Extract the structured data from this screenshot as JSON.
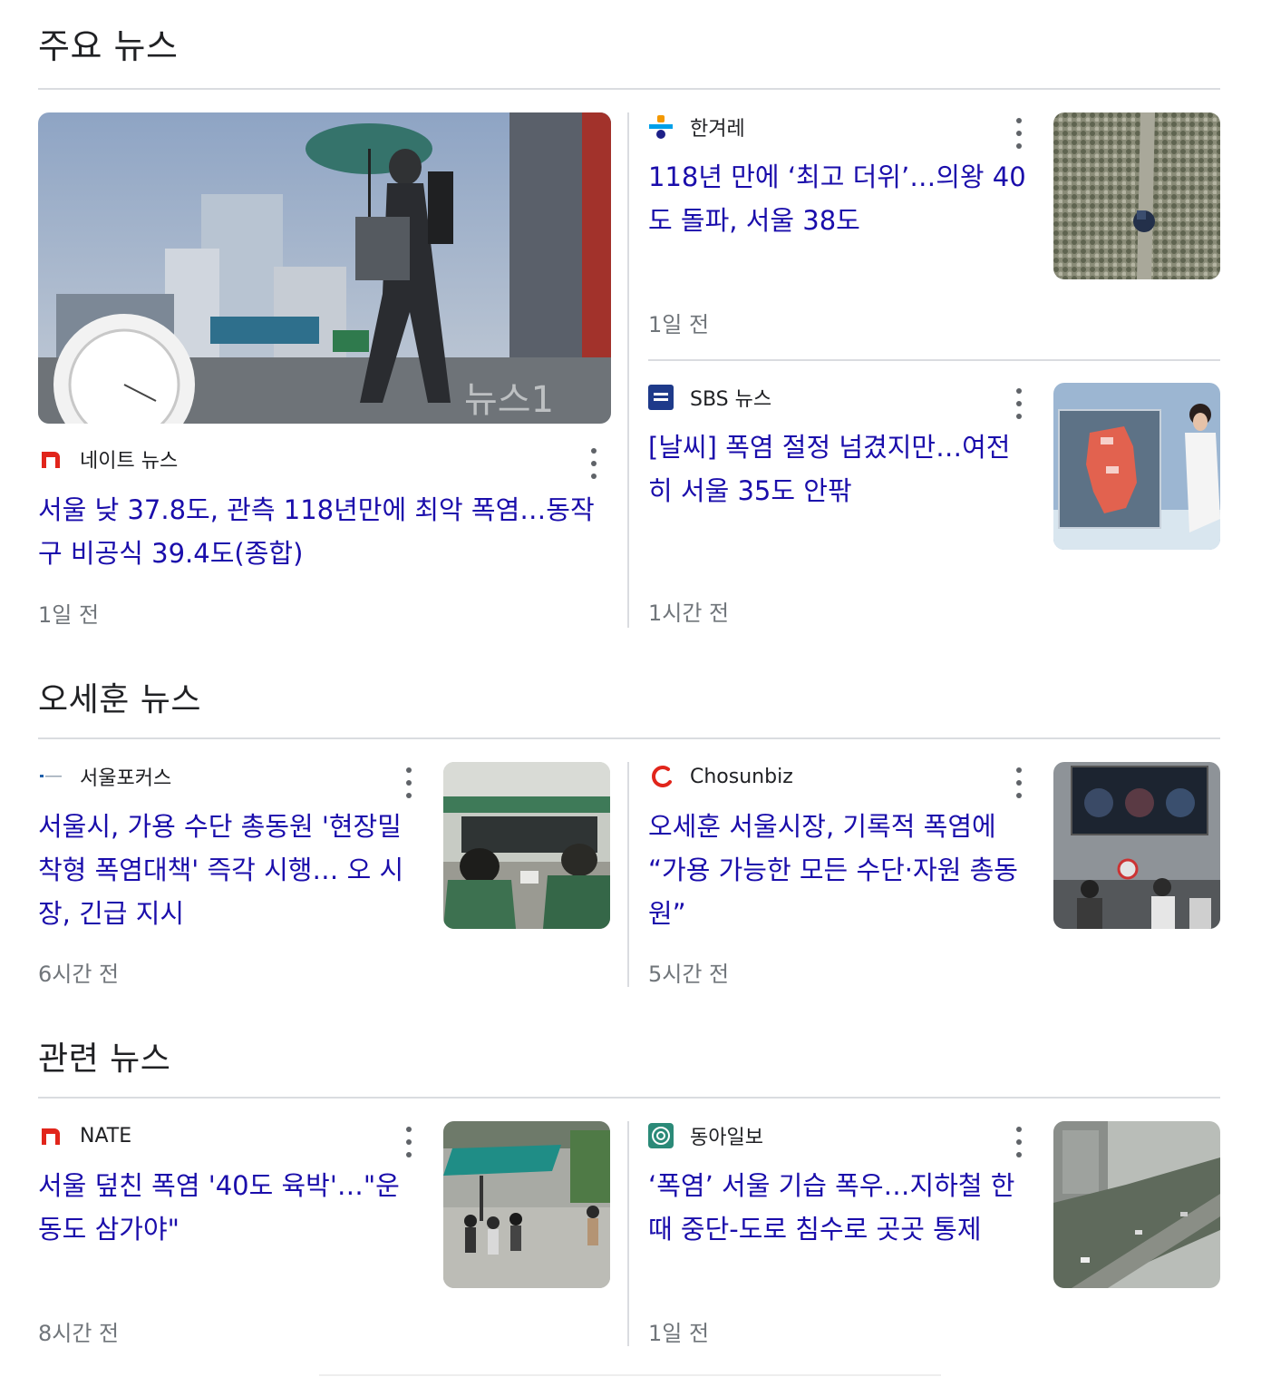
{
  "sections": [
    {
      "title": "주요 뉴스",
      "articles": [
        {
          "source": "네이트 뉴스",
          "headline": "서울 낮 37.8도, 관측 118년만에 최악 폭염…동작구 비공식 39.4도(종합)",
          "time": "1일 전",
          "logo_icon": "nate-logo-icon",
          "thumb_icon": "umbrella-pedestrian-photo"
        },
        {
          "source": "한겨레",
          "headline": "118년 만에 ‘최고 더위’…의왕 40도 돌파, 서울 38도",
          "time": "1일 전",
          "logo_icon": "hankyoreh-logo-icon",
          "thumb_icon": "crop-field-aerial-photo"
        },
        {
          "source": "SBS 뉴스",
          "headline": "[날씨] 폭염 절정 넘겼지만…여전히 서울 35도 안팎",
          "time": "1시간 전",
          "logo_icon": "sbs-logo-icon",
          "thumb_icon": "weather-map-photo"
        }
      ]
    },
    {
      "title": "오세훈 뉴스",
      "articles": [
        {
          "source": "서울포커스",
          "headline": "서울시, 가용 수단 총동원 '현장밀착형 폭염대책' 즉각 시행… 오 시장, 긴급 지시",
          "time": "6시간 전",
          "logo_icon": "seoulfocus-logo-icon",
          "thumb_icon": "meeting-room-photo"
        },
        {
          "source": "Chosunbiz",
          "headline": "오세훈 서울시장, 기록적 폭염에 “가용 가능한 모든 수단·자원 총동원”",
          "time": "5시간 전",
          "logo_icon": "chosunbiz-logo-icon",
          "thumb_icon": "street-crowd-photo"
        }
      ]
    },
    {
      "title": "관련 뉴스",
      "articles": [
        {
          "source": "NATE",
          "headline": "서울 덮친 폭염 '40도 육박'…\"운동도 삼가야\"",
          "time": "8시간 전",
          "logo_icon": "nate-logo-icon",
          "thumb_icon": "awning-crowd-photo"
        },
        {
          "source": "동아일보",
          "headline": "‘폭염’ 서울 기습 폭우…지하철 한때 중단-도로 침수로 곳곳 통제",
          "time": "1일 전",
          "logo_icon": "donga-logo-icon",
          "thumb_icon": "rainy-road-photo"
        }
      ]
    }
  ],
  "colors": {
    "headline": "#1a0dab",
    "source": "#202124",
    "time": "#70757a",
    "divider": "#dadce0"
  }
}
